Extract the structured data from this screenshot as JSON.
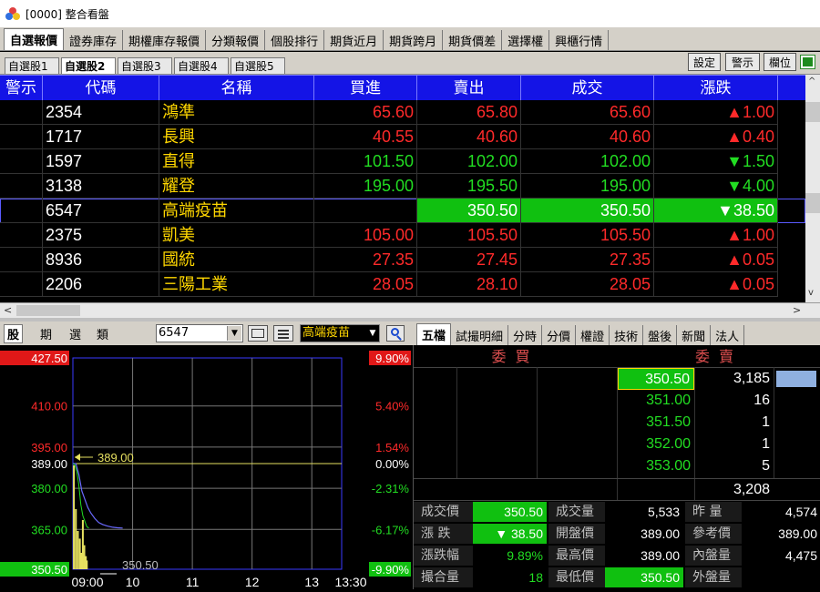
{
  "window": {
    "title": "[0000] 整合看盤"
  },
  "main_tabs": [
    {
      "label": "自選報價",
      "active": true
    },
    {
      "label": "證券庫存"
    },
    {
      "label": "期權庫存報價"
    },
    {
      "label": "分類報價"
    },
    {
      "label": "個股排行"
    },
    {
      "label": "期貨近月"
    },
    {
      "label": "期貨跨月"
    },
    {
      "label": "期貨價差"
    },
    {
      "label": "選擇權"
    },
    {
      "label": "興櫃行情"
    }
  ],
  "sub_tabs": [
    {
      "label": "自選股1"
    },
    {
      "label": "自選股2",
      "active": true
    },
    {
      "label": "自選股3"
    },
    {
      "label": "自選股4"
    },
    {
      "label": "自選股5"
    }
  ],
  "toolbar": {
    "settings": "設定",
    "alert": "警示",
    "columns": "欄位",
    "export_icon": "excel-export-icon"
  },
  "quote_table": {
    "columns": [
      "警示",
      "代碼",
      "名稱",
      "買進",
      "賣出",
      "成交",
      "漲跌"
    ],
    "rows": [
      {
        "code": "2354",
        "name": "鴻準",
        "bid": "65.60",
        "ask": "65.80",
        "last": "65.60",
        "change": "▲1.00",
        "color": "#ff2a2a"
      },
      {
        "code": "1717",
        "name": "長興",
        "bid": "40.55",
        "ask": "40.60",
        "last": "40.60",
        "change": "▲0.40",
        "color": "#ff2a2a"
      },
      {
        "code": "1597",
        "name": "直得",
        "bid": "101.50",
        "ask": "102.00",
        "last": "102.00",
        "change": "▼1.50",
        "color": "#22dd22"
      },
      {
        "code": "3138",
        "name": "耀登",
        "bid": "195.00",
        "ask": "195.50",
        "last": "195.00",
        "change": "▼4.00",
        "color": "#22dd22"
      },
      {
        "code": "6547",
        "name": "高端疫苗",
        "bid": "",
        "ask": "350.50",
        "last": "350.50",
        "change": "▼38.50",
        "color": "#ffffff",
        "highlight": true
      },
      {
        "code": "2375",
        "name": "凱美",
        "bid": "105.00",
        "ask": "105.50",
        "last": "105.50",
        "change": "▲1.00",
        "color": "#ff2a2a"
      },
      {
        "code": "8936",
        "name": "國統",
        "bid": "27.35",
        "ask": "27.45",
        "last": "27.35",
        "change": "▲0.05",
        "color": "#ff2a2a"
      },
      {
        "code": "2206",
        "name": "三陽工業",
        "bid": "28.05",
        "ask": "28.10",
        "last": "28.05",
        "change": "▲0.05",
        "color": "#ff2a2a"
      }
    ]
  },
  "left_panel": {
    "tabs": [
      "股",
      "期",
      "選",
      "類"
    ],
    "stock_code": "6547",
    "stock_name": "高端疫苗",
    "icons": [
      "chart-window-icon",
      "list-toggle-icon",
      "search-icon"
    ]
  },
  "chart_data": {
    "type": "line",
    "y_labels_left": [
      "427.50",
      "410.00",
      "395.00",
      "389.00",
      "380.00",
      "365.00",
      "350.50"
    ],
    "y_labels_right": [
      "9.90%",
      "5.40%",
      "1.54%",
      "0.00%",
      "-2.31%",
      "-6.17%",
      "-9.90%"
    ],
    "x_labels": [
      "09:00",
      "10",
      "11",
      "12",
      "13",
      "13:30"
    ],
    "ylim": [
      350.5,
      427.5
    ],
    "reference_price": 389.0,
    "reference_label": "389.00",
    "low_label": "350.50",
    "price_series": [
      {
        "t": 0,
        "p": 389
      },
      {
        "t": 3,
        "p": 389
      },
      {
        "t": 6,
        "p": 385
      },
      {
        "t": 9,
        "p": 379
      },
      {
        "t": 12,
        "p": 376
      },
      {
        "t": 15,
        "p": 373
      },
      {
        "t": 18,
        "p": 371
      },
      {
        "t": 22,
        "p": 369
      },
      {
        "t": 26,
        "p": 367.5
      },
      {
        "t": 30,
        "p": 366.8
      },
      {
        "t": 35,
        "p": 366.2
      },
      {
        "t": 40,
        "p": 365.8
      },
      {
        "t": 45,
        "p": 365.6
      },
      {
        "t": 50,
        "p": 365.5
      }
    ],
    "avg_series": [
      {
        "t": 0,
        "p": 389
      },
      {
        "t": 2,
        "p": 388.5
      },
      {
        "t": 4,
        "p": 386
      },
      {
        "t": 6,
        "p": 381
      },
      {
        "t": 8,
        "p": 374
      },
      {
        "t": 10,
        "p": 370
      },
      {
        "t": 12,
        "p": 368
      },
      {
        "t": 14,
        "p": 366
      },
      {
        "t": 16,
        "p": 365.5
      }
    ],
    "volume": [
      {
        "t": 1,
        "v": 0.95
      },
      {
        "t": 3,
        "v": 0.55
      },
      {
        "t": 5,
        "v": 0.35
      },
      {
        "t": 7,
        "v": 0.28
      },
      {
        "t": 8.5,
        "v": 0.15
      },
      {
        "t": 10,
        "v": 0.45
      },
      {
        "t": 11.5,
        "v": 0.22
      },
      {
        "t": 13,
        "v": 0.12
      },
      {
        "t": 14,
        "v": 0.08
      }
    ]
  },
  "right_tabs": [
    "五檔",
    "試撮明細",
    "分時",
    "分價",
    "權證",
    "技術",
    "盤後",
    "新聞",
    "法人"
  ],
  "order_book": {
    "bid_header": "委買",
    "ask_header": "委賣",
    "asks": [
      {
        "price": "350.50",
        "vol": "3,185",
        "highlight": true
      },
      {
        "price": "351.00",
        "vol": "16"
      },
      {
        "price": "351.50",
        "vol": "1"
      },
      {
        "price": "352.00",
        "vol": "1"
      },
      {
        "price": "353.00",
        "vol": "5"
      }
    ],
    "ask_total": "3,208"
  },
  "info": {
    "rows": [
      [
        {
          "label": "成交價",
          "value": "350.50",
          "hl": true
        },
        {
          "label": "成交量",
          "value": "5,533"
        },
        {
          "label": "昨 量",
          "value": "4,574"
        }
      ],
      [
        {
          "label": "漲 跌",
          "value": "▼ 38.50",
          "hl": true
        },
        {
          "label": "開盤價",
          "value": "389.00"
        },
        {
          "label": "參考價",
          "value": "389.00"
        }
      ],
      [
        {
          "label": "漲跌幅",
          "value": "9.89%",
          "color": "#22dd22"
        },
        {
          "label": "最高價",
          "value": "389.00"
        },
        {
          "label": "內盤量",
          "value": "4,475"
        }
      ],
      [
        {
          "label": "撮合量",
          "value": "18",
          "color": "#22dd22"
        },
        {
          "label": "最低價",
          "value": "350.50",
          "hl": true
        },
        {
          "label": "外盤量",
          "value": ""
        }
      ]
    ]
  }
}
